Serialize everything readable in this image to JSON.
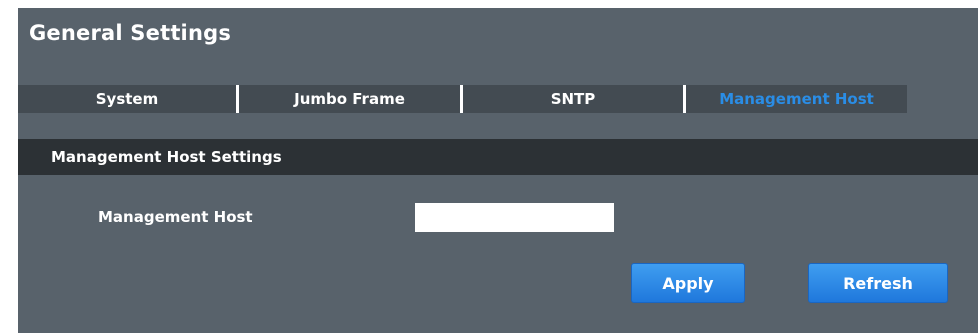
{
  "page": {
    "title": "General Settings"
  },
  "tabs": [
    {
      "label": "System",
      "active": false
    },
    {
      "label": "Jumbo Frame",
      "active": false
    },
    {
      "label": "SNTP",
      "active": false
    },
    {
      "label": "Management Host",
      "active": true
    }
  ],
  "section": {
    "title": "Management Host Settings"
  },
  "form": {
    "management_host_label": "Management Host",
    "management_host_value": ""
  },
  "buttons": {
    "apply": "Apply",
    "refresh": "Refresh"
  },
  "colors": {
    "panel_bg": "#58626b",
    "tabbar_bg": "#434b52",
    "section_bg": "#2c3135",
    "active_tab": "#2a8de6",
    "button_blue": "#2a8de6"
  }
}
